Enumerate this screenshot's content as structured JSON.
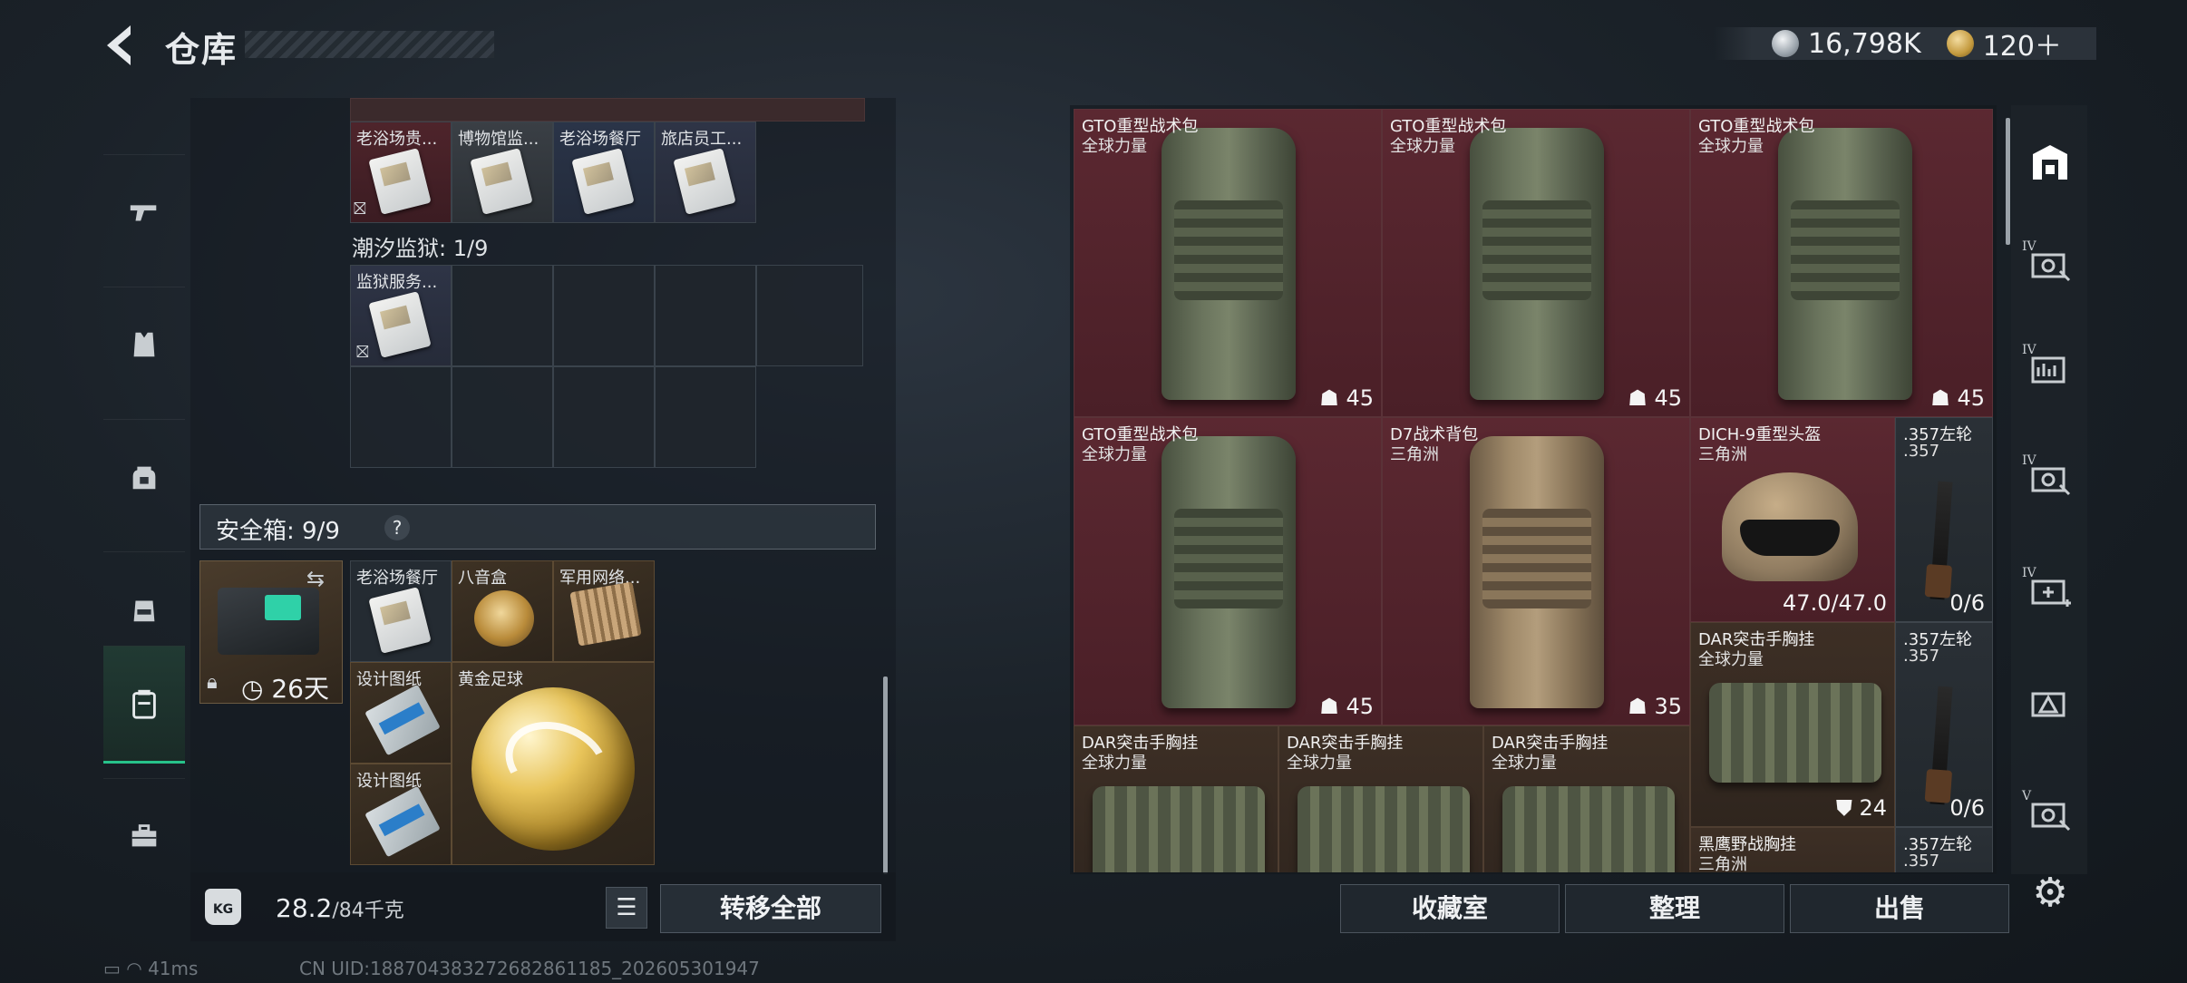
{
  "header": {
    "title": "仓库",
    "silver_amount": "16,798K",
    "gold_amount": "120＋"
  },
  "left_nav": [
    "weapons",
    "armor",
    "backpack",
    "rig",
    "keycards",
    "tools"
  ],
  "storage": {
    "top_row_items": [
      "老浴场贵...",
      "博物馆监...",
      "老浴场餐厅",
      "旅店员工..."
    ],
    "prison_section_label": "潮汐监狱: 1/9",
    "prison_items": [
      "监狱服务..."
    ]
  },
  "safebox": {
    "label": "安全箱: 9/9",
    "help": "?",
    "timer": "26天",
    "items": {
      "r1c1": "老浴场餐厅",
      "r1c2": "八音盒",
      "r1c3": "军用网络...",
      "r2c1": "设计图纸",
      "r2c2": "黄金足球",
      "r3c1": "设计图纸"
    }
  },
  "footer_left": {
    "weight_value": "28.2",
    "weight_unit": "/84千克",
    "kg_icon_text": "KG",
    "transfer_label": "转移全部"
  },
  "right_items": {
    "i1": {
      "name": "GTO重型战术包",
      "sub": "全球力量",
      "stat": "45"
    },
    "i2": {
      "name": "GTO重型战术包",
      "sub": "全球力量",
      "stat": "45"
    },
    "i3": {
      "name": "GTO重型战术包",
      "sub": "全球力量",
      "stat": "45"
    },
    "i4": {
      "name": "GTO重型战术包",
      "sub": "全球力量",
      "stat": "45"
    },
    "i5": {
      "name": "D7战术背包",
      "sub": "三角洲",
      "stat": "35"
    },
    "i6": {
      "name": "DICH-9重型头盔",
      "sub": "三角洲",
      "stat": "47.0/47.0"
    },
    "i7": {
      "name": ".357左轮",
      "sub": ".357",
      "stat": "0/6"
    },
    "i8": {
      "name": "DAR突击手胸挂",
      "sub": "全球力量",
      "stat": "24"
    },
    "i9": {
      "name": ".357左轮",
      "sub": ".357",
      "stat": "0/6"
    },
    "i10": {
      "name": "DAR突击手胸挂",
      "sub": "全球力量"
    },
    "i11": {
      "name": "DAR突击手胸挂",
      "sub": "全球力量"
    },
    "i12": {
      "name": "DAR突击手胸挂",
      "sub": "全球力量"
    },
    "i13": {
      "name": "黑鹰野战胸挂",
      "sub": "三角洲"
    },
    "i14": {
      "name": ".357左轮",
      "sub": ".357"
    }
  },
  "tools": {
    "badge_iv": "IV",
    "badge_v": "V"
  },
  "bottom_buttons": {
    "collection": "收藏室",
    "organize": "整理",
    "sell": "出售"
  },
  "status": {
    "ping": "41ms",
    "uid": "CN UID:188704383272682861185_202605301947"
  }
}
